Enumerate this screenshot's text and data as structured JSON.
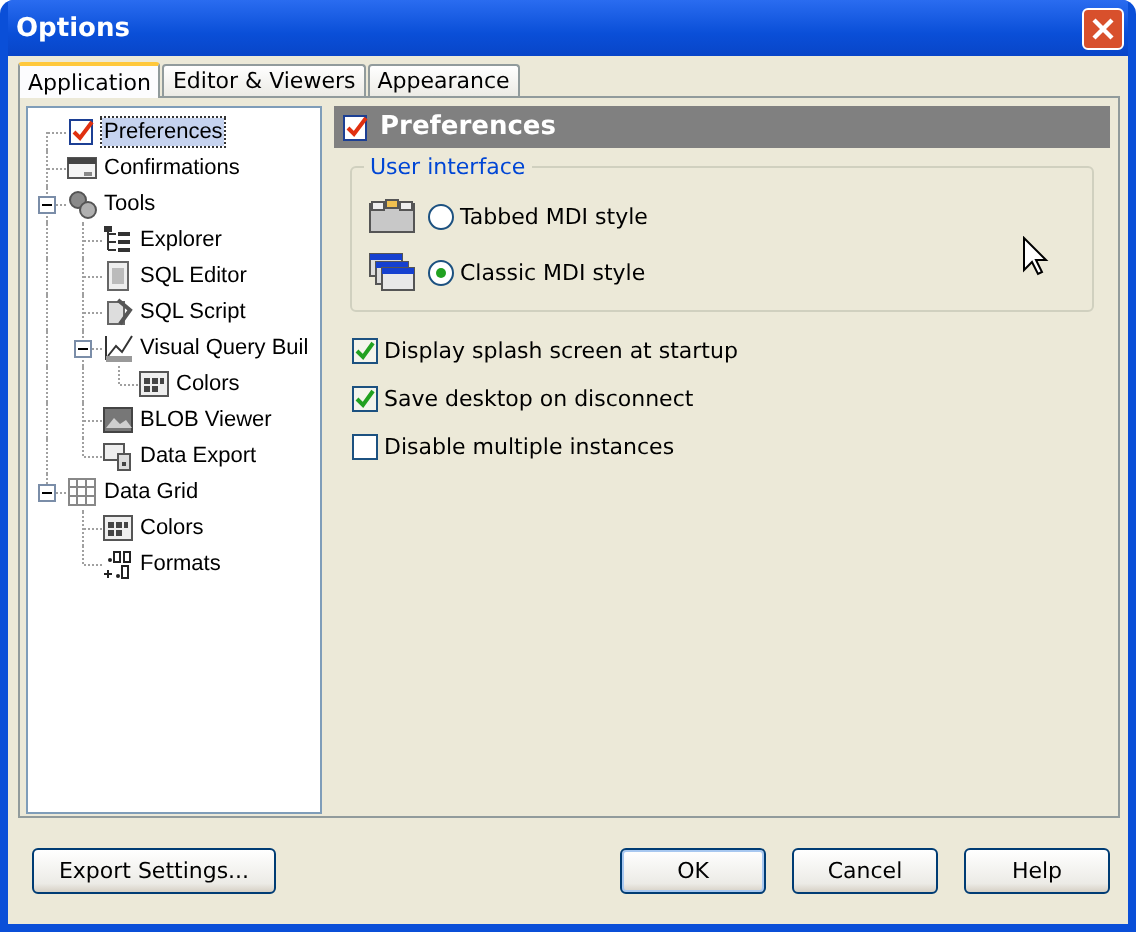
{
  "window": {
    "title": "Options"
  },
  "tabs": [
    {
      "label": "Application",
      "selected": true
    },
    {
      "label": "Editor & Viewers",
      "selected": false
    },
    {
      "label": "Appearance",
      "selected": false
    }
  ],
  "tree": [
    {
      "label": "Preferences",
      "selected": true
    },
    {
      "label": "Confirmations",
      "selected": false
    },
    {
      "label": "Tools",
      "selected": false,
      "expanded": true,
      "children": [
        {
          "label": "Explorer",
          "selected": false
        },
        {
          "label": "SQL Editor",
          "selected": false
        },
        {
          "label": "SQL Script",
          "selected": false
        },
        {
          "label": "Visual Query Buil",
          "selected": false,
          "expanded": true,
          "children": [
            {
              "label": "Colors",
              "selected": false
            }
          ]
        },
        {
          "label": "BLOB Viewer",
          "selected": false
        },
        {
          "label": "Data Export",
          "selected": false
        }
      ]
    },
    {
      "label": "Data Grid",
      "selected": false,
      "expanded": true,
      "children": [
        {
          "label": "Colors",
          "selected": false
        },
        {
          "label": "Formats",
          "selected": false
        }
      ]
    }
  ],
  "panel": {
    "title": "Preferences",
    "group": {
      "label": "User interface",
      "options": [
        {
          "label": "Tabbed MDI style",
          "selected": false
        },
        {
          "label": "Classic MDI style",
          "selected": true
        }
      ]
    },
    "checkboxes": [
      {
        "label": "Display splash screen at startup",
        "checked": true
      },
      {
        "label": "Save desktop on disconnect",
        "checked": true
      },
      {
        "label": "Disable multiple instances",
        "checked": false
      }
    ]
  },
  "footer": {
    "left_button": "Export Settings...",
    "buttons": [
      {
        "label": "OK",
        "default": true
      },
      {
        "label": "Cancel",
        "default": false
      },
      {
        "label": "Help",
        "default": false
      }
    ]
  }
}
